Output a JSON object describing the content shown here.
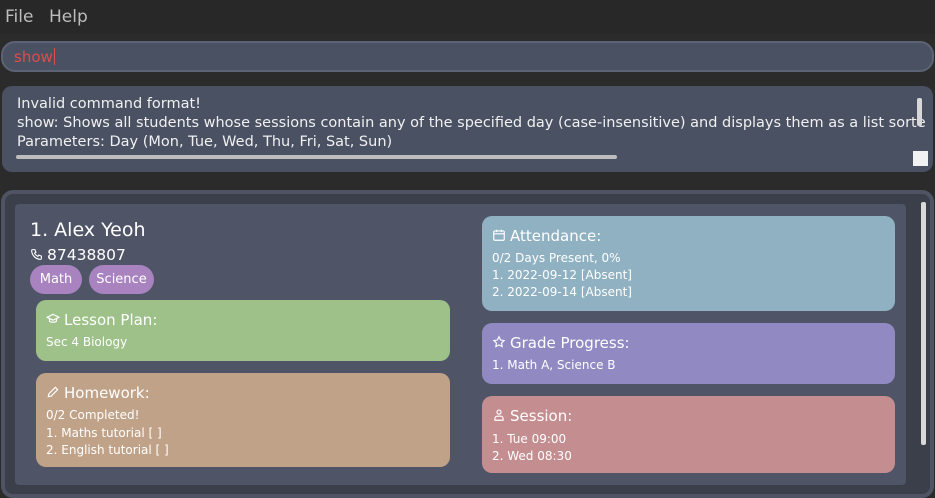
{
  "menu": {
    "file": "File",
    "help": "Help"
  },
  "command": {
    "value": "show"
  },
  "result": {
    "line1": "Invalid command format!",
    "line2": "show: Shows all students whose sessions contain any of the specified day (case-insensitive) and displays them as a list sorte",
    "line3": "Parameters: Day (Mon, Tue, Wed, Thu, Fri, Sat, Sun)"
  },
  "student": {
    "name": "1.  Alex Yeoh",
    "phone": "87438807",
    "tags": [
      "Math",
      "Science"
    ],
    "lesson_plan": {
      "title": "Lesson Plan:",
      "lines": [
        "Sec 4 Biology"
      ]
    },
    "homework": {
      "title": "Homework:",
      "lines": [
        "0/2 Completed!",
        "1. Maths tutorial [ ]",
        "2. English tutorial [ ]"
      ]
    },
    "attendance": {
      "title": "Attendance:",
      "lines": [
        "0/2 Days Present, 0%",
        "1. 2022-09-12 [Absent]",
        "2. 2022-09-14 [Absent]"
      ]
    },
    "grade_progress": {
      "title": "Grade Progress:",
      "lines": [
        "1. Math A, Science B"
      ]
    },
    "session": {
      "title": "Session:",
      "lines": [
        "1. Tue 09:00",
        "2. Wed 08:30"
      ]
    }
  },
  "colors": {
    "lesson_plan": "#9ec18a",
    "homework": "#c0a288",
    "attendance": "#8fb1c2",
    "grade_progress": "#9089c2",
    "session": "#c48e91",
    "tag": "#a883c0",
    "command_text": "#e04b4b"
  },
  "icons": {
    "phone": "phone-icon",
    "lesson_plan": "graduation-cap-icon",
    "homework": "pencil-icon",
    "attendance": "calendar-icon",
    "grade_progress": "star-icon",
    "session": "user-group-icon"
  }
}
